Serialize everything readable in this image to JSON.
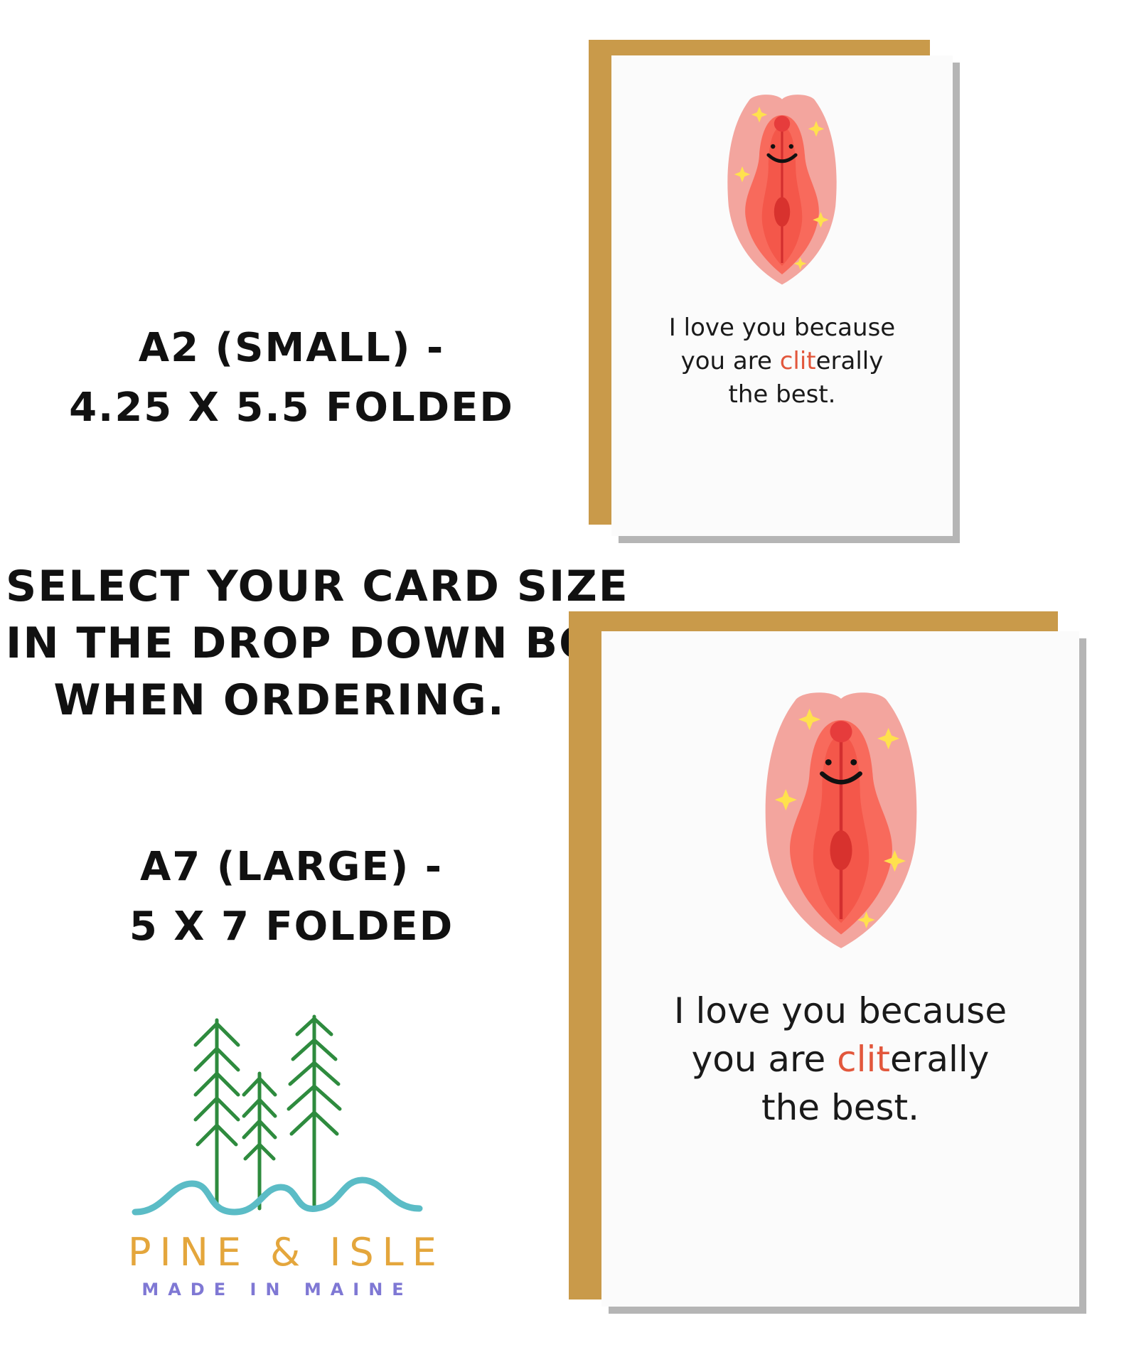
{
  "left_column": {
    "a2_label": [
      "A2 (SMALL) -",
      "4.25 X 5.5 FOLDED"
    ],
    "select_instruction": [
      "SELECT YOUR CARD SIZE",
      "IN THE DROP DOWN BOX",
      "WHEN ORDERING."
    ],
    "a7_label": [
      "A7 (LARGE) -",
      "5 X 7 FOLDED"
    ]
  },
  "card": {
    "line1": "I love you because",
    "line2_before": "you are ",
    "line2_highlight": "clit",
    "line2_after": "erally",
    "line3": "the best."
  },
  "logo": {
    "name": "PINE & ISLE",
    "tagline": "MADE IN MAINE"
  },
  "colors": {
    "envelope": "#c99a4a",
    "highlight": "#e2573c",
    "logo_name": "#e4a63c",
    "logo_tagline": "#7f78d4",
    "trees": "#2e8b3e",
    "waves": "#5bbcc6"
  }
}
